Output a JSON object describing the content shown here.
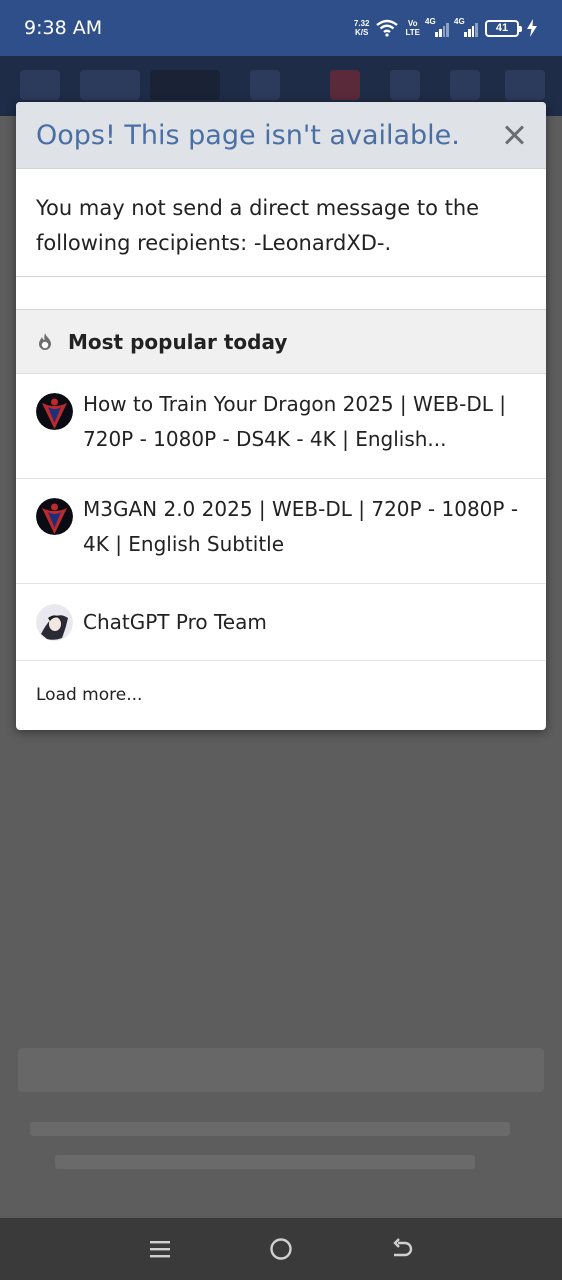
{
  "status_bar": {
    "time": "9:38 AM",
    "net_speed_value": "7.32",
    "net_speed_unit": "K/S",
    "volte_top": "Vo",
    "volte_bottom": "LTE",
    "signal1_label": "4G",
    "signal2_label": "4G",
    "battery": "41",
    "icons": [
      "wifi-icon",
      "signal-icon",
      "signal-icon",
      "battery-icon",
      "charging-icon"
    ]
  },
  "dialog": {
    "title": "Oops! This page isn't available.",
    "message": "You may not send a direct message to the following recipients: -LeonardXD-.",
    "popular": {
      "heading": "Most popular today",
      "icon": "fire-icon",
      "items": [
        {
          "text": "How to Train Your Dragon 2025 | WEB-DL | 720P - 1080P - DS4K - 4K | English...",
          "avatar": "spiderman-avatar"
        },
        {
          "text": "M3GAN 2.0 2025 | WEB-DL | 720P - 1080P - 4K | English Subtitle",
          "avatar": "spiderman-avatar"
        },
        {
          "text": "ChatGPT Pro Team",
          "avatar": "anime-avatar"
        }
      ],
      "load_more": "Load more..."
    }
  },
  "nav_bar": {
    "icons": [
      "menu-icon",
      "home-icon",
      "back-icon"
    ]
  },
  "colors": {
    "status_bar": "#2f4f8a",
    "dialog_title": "#4a6fa5",
    "dialog_header_bg": "#dfe3e8",
    "overlay": "#5b5b5b"
  }
}
